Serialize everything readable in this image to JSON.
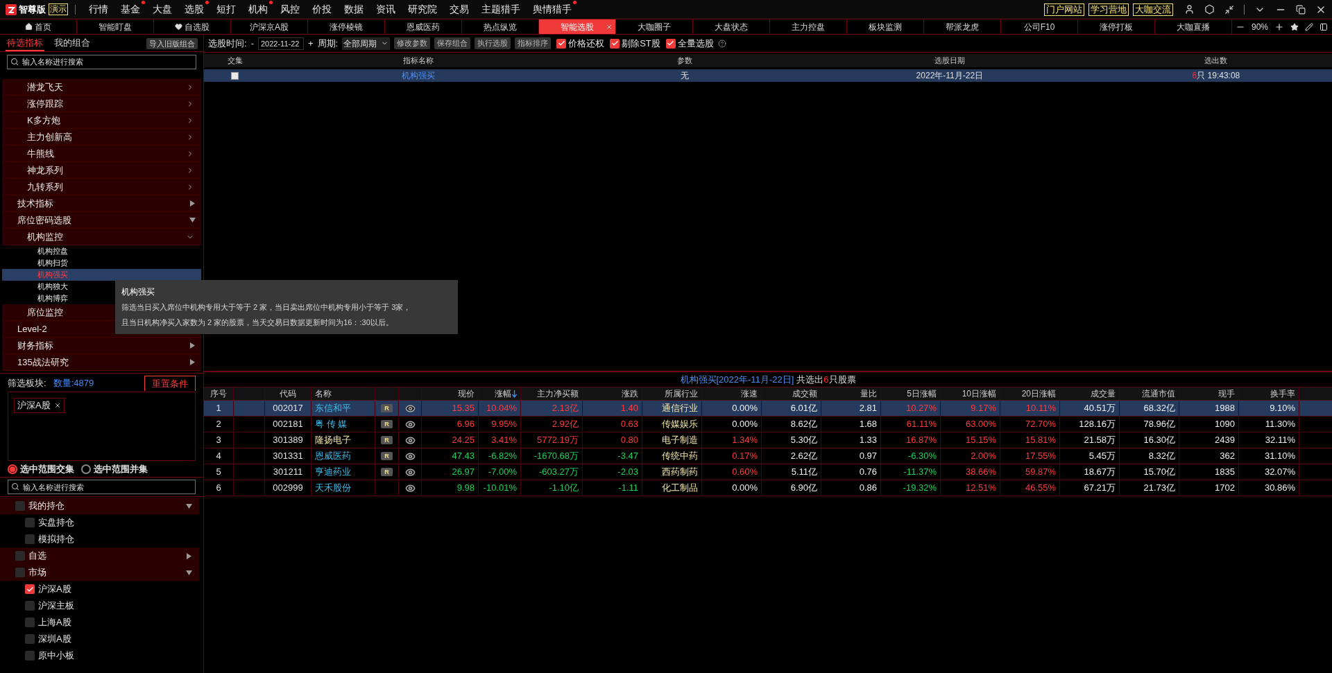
{
  "app": {
    "edition": "智尊版",
    "mode": "演示"
  },
  "menu": [
    {
      "label": "行情",
      "dot": false
    },
    {
      "label": "基金",
      "dot": true
    },
    {
      "label": "大盘",
      "dot": false
    },
    {
      "label": "选股",
      "dot": true
    },
    {
      "label": "短打",
      "dot": false
    },
    {
      "label": "机构",
      "dot": true
    },
    {
      "label": "风控",
      "dot": false
    },
    {
      "label": "价投",
      "dot": false
    },
    {
      "label": "数据",
      "dot": false
    },
    {
      "label": "资讯",
      "dot": false
    },
    {
      "label": "研究院",
      "dot": false
    },
    {
      "label": "交易",
      "dot": false
    },
    {
      "label": "主题猎手",
      "dot": false
    },
    {
      "label": "舆情猎手",
      "dot": true
    }
  ],
  "links": [
    "门户网站",
    "学习营地",
    "大咖交流"
  ],
  "tabs": [
    {
      "label": "首页",
      "kind": "home",
      "selected": false
    },
    {
      "label": "智能盯盘",
      "kind": "plain",
      "selected": false
    },
    {
      "label": "自选股",
      "kind": "favorite",
      "selected": false
    },
    {
      "label": "沪深京A股",
      "kind": "plain",
      "selected": false
    },
    {
      "label": "涨停棱镜",
      "kind": "plain",
      "selected": false
    },
    {
      "label": "恩威医药",
      "kind": "plain",
      "selected": false
    },
    {
      "label": "热点纵览",
      "kind": "plain",
      "selected": false
    },
    {
      "label": "智能选股",
      "kind": "plain",
      "selected": true
    },
    {
      "label": "大咖圈子",
      "kind": "plain",
      "selected": false
    },
    {
      "label": "大盘状态",
      "kind": "plain",
      "selected": false
    },
    {
      "label": "主力控盘",
      "kind": "plain",
      "selected": false
    },
    {
      "label": "板块监测",
      "kind": "plain",
      "selected": false
    },
    {
      "label": "帮派龙虎",
      "kind": "plain",
      "selected": false
    },
    {
      "label": "公司F10",
      "kind": "plain",
      "selected": false
    },
    {
      "label": "涨停打板",
      "kind": "plain",
      "selected": false
    },
    {
      "label": "大咖直播",
      "kind": "plain",
      "selected": false
    }
  ],
  "zoom": "90%",
  "sidebar": {
    "tabs": [
      {
        "label": "待选指标",
        "selected": true
      },
      {
        "label": "我的组合",
        "selected": false
      }
    ],
    "import_button": "导入旧版组合",
    "search": {
      "placeholder": "输入名称进行搜索"
    },
    "tree": [
      {
        "children": [
          {
            "label": "潜龙飞天",
            "expanded": false
          },
          {
            "label": "涨停跟踪",
            "expanded": false
          },
          {
            "label": "K多方炮",
            "expanded": false
          },
          {
            "label": "主力创新高",
            "expanded": false
          },
          {
            "label": "牛熊线",
            "expanded": false
          },
          {
            "label": "神龙系列",
            "expanded": false
          },
          {
            "label": "九转系列",
            "expanded": false
          }
        ]
      },
      {
        "label": "技术指标",
        "expanded": false
      },
      {
        "label": "席位密码选股",
        "expanded": true,
        "children": [
          {
            "label": "机构监控",
            "expanded": true,
            "children": [
              {
                "label": "机构控盘",
                "selected": false
              },
              {
                "label": "机构扫货",
                "selected": false
              },
              {
                "label": "机构强买",
                "selected": true
              },
              {
                "label": "机构独大",
                "selected": false
              },
              {
                "label": "机构博弈",
                "selected": false
              }
            ]
          },
          {
            "label": "席位监控",
            "expanded": false
          }
        ]
      },
      {
        "label": "Level-2",
        "expanded": false
      },
      {
        "label": "财务指标",
        "expanded": false
      },
      {
        "label": "135战法研究",
        "expanded": false
      }
    ]
  },
  "toolbar": {
    "date_label": "选股时间:",
    "minus": "-",
    "date": "2022-11-22",
    "plus": "+",
    "period_label": "周期:",
    "period": "全部周期",
    "buttons": [
      "修改参数",
      "保存组合",
      "执行选股",
      "指标排序"
    ],
    "options": [
      {
        "label": "价格还权",
        "checked": true
      },
      {
        "label": "剔除ST股",
        "checked": true
      },
      {
        "label": "全量选股",
        "checked": true
      }
    ]
  },
  "tooltip": {
    "title": "机构强买",
    "lines": [
      "筛选当日买入席位中机构专用大于等于 2 家，当日卖出席位中机构专用小于等于 3家，",
      "且当日机构净买入家数为 2 家的股票，当天交易日数据更新时间为16：:30以后。"
    ]
  },
  "indicator_table": {
    "columns": [
      "交集",
      "指标名称",
      "参数",
      "选股日期",
      "选出数"
    ],
    "rows": [
      {
        "selected": true,
        "checked": false,
        "name": "机构强买",
        "params": "无",
        "date": "2022年-11月-22日",
        "count": "6",
        "unit": "只",
        "time": "19:43:08"
      }
    ]
  },
  "filter": {
    "label": "筛选板块:",
    "count": "数量:4879",
    "reset": "重置条件",
    "chips": [
      "沪深A股"
    ],
    "modes": [
      {
        "label": "选中范围交集",
        "selected": true
      },
      {
        "label": "选中范围并集",
        "selected": false
      }
    ],
    "search": {
      "placeholder": "输入名称进行搜索"
    },
    "tree": [
      {
        "label": "我的持仓",
        "checked": false,
        "expanded": true,
        "children": [
          {
            "label": "实盘持仓",
            "checked": false
          },
          {
            "label": "模拟持仓",
            "checked": false
          }
        ]
      },
      {
        "label": "自选",
        "checked": false,
        "expanded": false
      },
      {
        "label": "市场",
        "checked": false,
        "expanded": true,
        "children": [
          {
            "label": "沪深A股",
            "checked": true
          },
          {
            "label": "沪深主板",
            "checked": false
          },
          {
            "label": "上海A股",
            "checked": false
          },
          {
            "label": "深圳A股",
            "checked": false
          },
          {
            "label": "原中小板",
            "checked": false
          }
        ]
      }
    ]
  },
  "results": {
    "title": "机构强买[2022年-11月-22日]",
    "prefix": "共选出",
    "count": "6",
    "suffix": "只股票",
    "columns": [
      {
        "label": "序号"
      },
      {
        "label": "代码"
      },
      {
        "label": "名称"
      },
      {
        "label": "现价",
        "sorted": false
      },
      {
        "label": "涨幅",
        "sorted": true
      },
      {
        "label": "主力净买额",
        "sorted": false
      },
      {
        "label": "涨跌",
        "sorted": false
      },
      {
        "label": "所属行业",
        "sorted": false
      },
      {
        "label": "涨速",
        "sorted": false
      },
      {
        "label": "成交额",
        "sorted": false
      },
      {
        "label": "量比",
        "sorted": false
      },
      {
        "label": "5日涨幅",
        "sorted": false
      },
      {
        "label": "10日涨幅",
        "sorted": false
      },
      {
        "label": "20日涨幅",
        "sorted": false
      },
      {
        "label": "成交量",
        "sorted": false
      },
      {
        "label": "流通市值",
        "sorted": false
      },
      {
        "label": "现手",
        "sorted": false
      },
      {
        "label": "换手率",
        "sorted": false
      }
    ],
    "rows": [
      {
        "selected": true,
        "no": "1",
        "code": "002017",
        "name": "东信和平",
        "kind": "standard",
        "badge": "R",
        "values": [
          {
            "text": "15.35",
            "kind": "up"
          },
          {
            "text": "10.04%",
            "kind": "up"
          },
          {
            "text": "2.13亿",
            "kind": "up"
          },
          {
            "text": "1.40",
            "kind": "up"
          },
          {
            "text": "通信行业",
            "kind": "sector"
          },
          {
            "text": "0.00%",
            "kind": "flat"
          },
          {
            "text": "6.01亿",
            "kind": "flat"
          },
          {
            "text": "2.81",
            "kind": "flat"
          },
          {
            "text": "10.27%",
            "kind": "up"
          },
          {
            "text": "9.17%",
            "kind": "up"
          },
          {
            "text": "10.11%",
            "kind": "up"
          },
          {
            "text": "40.51万",
            "kind": "flat"
          },
          {
            "text": "68.32亿",
            "kind": "flat"
          },
          {
            "text": "1988",
            "kind": "flat"
          },
          {
            "text": "9.10%",
            "kind": "flat"
          }
        ]
      },
      {
        "selected": false,
        "no": "2",
        "code": "002181",
        "name": "粤 传 媒",
        "kind": "standard",
        "badge": "R",
        "values": [
          {
            "text": "6.96",
            "kind": "up"
          },
          {
            "text": "9.95%",
            "kind": "up"
          },
          {
            "text": "2.92亿",
            "kind": "up"
          },
          {
            "text": "0.63",
            "kind": "up"
          },
          {
            "text": "传媒娱乐",
            "kind": "sector"
          },
          {
            "text": "0.00%",
            "kind": "flat"
          },
          {
            "text": "8.62亿",
            "kind": "flat"
          },
          {
            "text": "1.68",
            "kind": "flat"
          },
          {
            "text": "61.11%",
            "kind": "up"
          },
          {
            "text": "63.00%",
            "kind": "up"
          },
          {
            "text": "72.70%",
            "kind": "up"
          },
          {
            "text": "128.16万",
            "kind": "flat"
          },
          {
            "text": "78.96亿",
            "kind": "flat"
          },
          {
            "text": "1090",
            "kind": "flat"
          },
          {
            "text": "11.30%",
            "kind": "flat"
          }
        ]
      },
      {
        "selected": false,
        "no": "3",
        "code": "301389",
        "name": "隆扬电子",
        "kind": "highlighted",
        "badge": "R",
        "values": [
          {
            "text": "24.25",
            "kind": "up"
          },
          {
            "text": "3.41%",
            "kind": "up"
          },
          {
            "text": "5772.19万",
            "kind": "up"
          },
          {
            "text": "0.80",
            "kind": "up"
          },
          {
            "text": "电子制造",
            "kind": "sector"
          },
          {
            "text": "1.34%",
            "kind": "up"
          },
          {
            "text": "5.30亿",
            "kind": "flat"
          },
          {
            "text": "1.33",
            "kind": "flat"
          },
          {
            "text": "16.87%",
            "kind": "up"
          },
          {
            "text": "15.15%",
            "kind": "up"
          },
          {
            "text": "15.81%",
            "kind": "up"
          },
          {
            "text": "21.58万",
            "kind": "flat"
          },
          {
            "text": "16.30亿",
            "kind": "flat"
          },
          {
            "text": "2439",
            "kind": "flat"
          },
          {
            "text": "32.11%",
            "kind": "flat"
          }
        ]
      },
      {
        "selected": false,
        "no": "4",
        "code": "301331",
        "name": "恩威医药",
        "kind": "standard",
        "badge": "R",
        "values": [
          {
            "text": "47.43",
            "kind": "down"
          },
          {
            "text": "-6.82%",
            "kind": "down"
          },
          {
            "text": "-1670.68万",
            "kind": "down"
          },
          {
            "text": "-3.47",
            "kind": "down"
          },
          {
            "text": "传统中药",
            "kind": "sector"
          },
          {
            "text": "0.17%",
            "kind": "up"
          },
          {
            "text": "2.62亿",
            "kind": "flat"
          },
          {
            "text": "0.97",
            "kind": "flat"
          },
          {
            "text": "-6.30%",
            "kind": "down"
          },
          {
            "text": "2.00%",
            "kind": "up"
          },
          {
            "text": "17.55%",
            "kind": "up"
          },
          {
            "text": "5.45万",
            "kind": "flat"
          },
          {
            "text": "8.32亿",
            "kind": "flat"
          },
          {
            "text": "362",
            "kind": "flat"
          },
          {
            "text": "31.10%",
            "kind": "flat"
          }
        ]
      },
      {
        "selected": false,
        "no": "5",
        "code": "301211",
        "name": "亨迪药业",
        "kind": "standard",
        "badge": "R",
        "values": [
          {
            "text": "26.97",
            "kind": "down"
          },
          {
            "text": "-7.00%",
            "kind": "down"
          },
          {
            "text": "-603.27万",
            "kind": "down"
          },
          {
            "text": "-2.03",
            "kind": "down"
          },
          {
            "text": "西药制药",
            "kind": "sector"
          },
          {
            "text": "0.60%",
            "kind": "up"
          },
          {
            "text": "5.11亿",
            "kind": "flat"
          },
          {
            "text": "0.76",
            "kind": "flat"
          },
          {
            "text": "-11.37%",
            "kind": "down"
          },
          {
            "text": "38.66%",
            "kind": "up"
          },
          {
            "text": "59.87%",
            "kind": "up"
          },
          {
            "text": "18.67万",
            "kind": "flat"
          },
          {
            "text": "15.70亿",
            "kind": "flat"
          },
          {
            "text": "1835",
            "kind": "flat"
          },
          {
            "text": "32.07%",
            "kind": "flat"
          }
        ]
      },
      {
        "selected": false,
        "no": "6",
        "code": "002999",
        "name": "天禾股份",
        "kind": "standard",
        "values": [
          {
            "text": "9.98",
            "kind": "down"
          },
          {
            "text": "-10.01%",
            "kind": "down"
          },
          {
            "text": "-1.10亿",
            "kind": "down"
          },
          {
            "text": "-1.11",
            "kind": "down"
          },
          {
            "text": "化工制品",
            "kind": "sector"
          },
          {
            "text": "0.00%",
            "kind": "flat"
          },
          {
            "text": "6.90亿",
            "kind": "flat"
          },
          {
            "text": "0.86",
            "kind": "flat"
          },
          {
            "text": "-19.32%",
            "kind": "down"
          },
          {
            "text": "12.51%",
            "kind": "up"
          },
          {
            "text": "46.55%",
            "kind": "up"
          },
          {
            "text": "67.21万",
            "kind": "flat"
          },
          {
            "text": "21.73亿",
            "kind": "flat"
          },
          {
            "text": "1702",
            "kind": "flat"
          },
          {
            "text": "30.86%",
            "kind": "flat"
          }
        ]
      }
    ]
  }
}
